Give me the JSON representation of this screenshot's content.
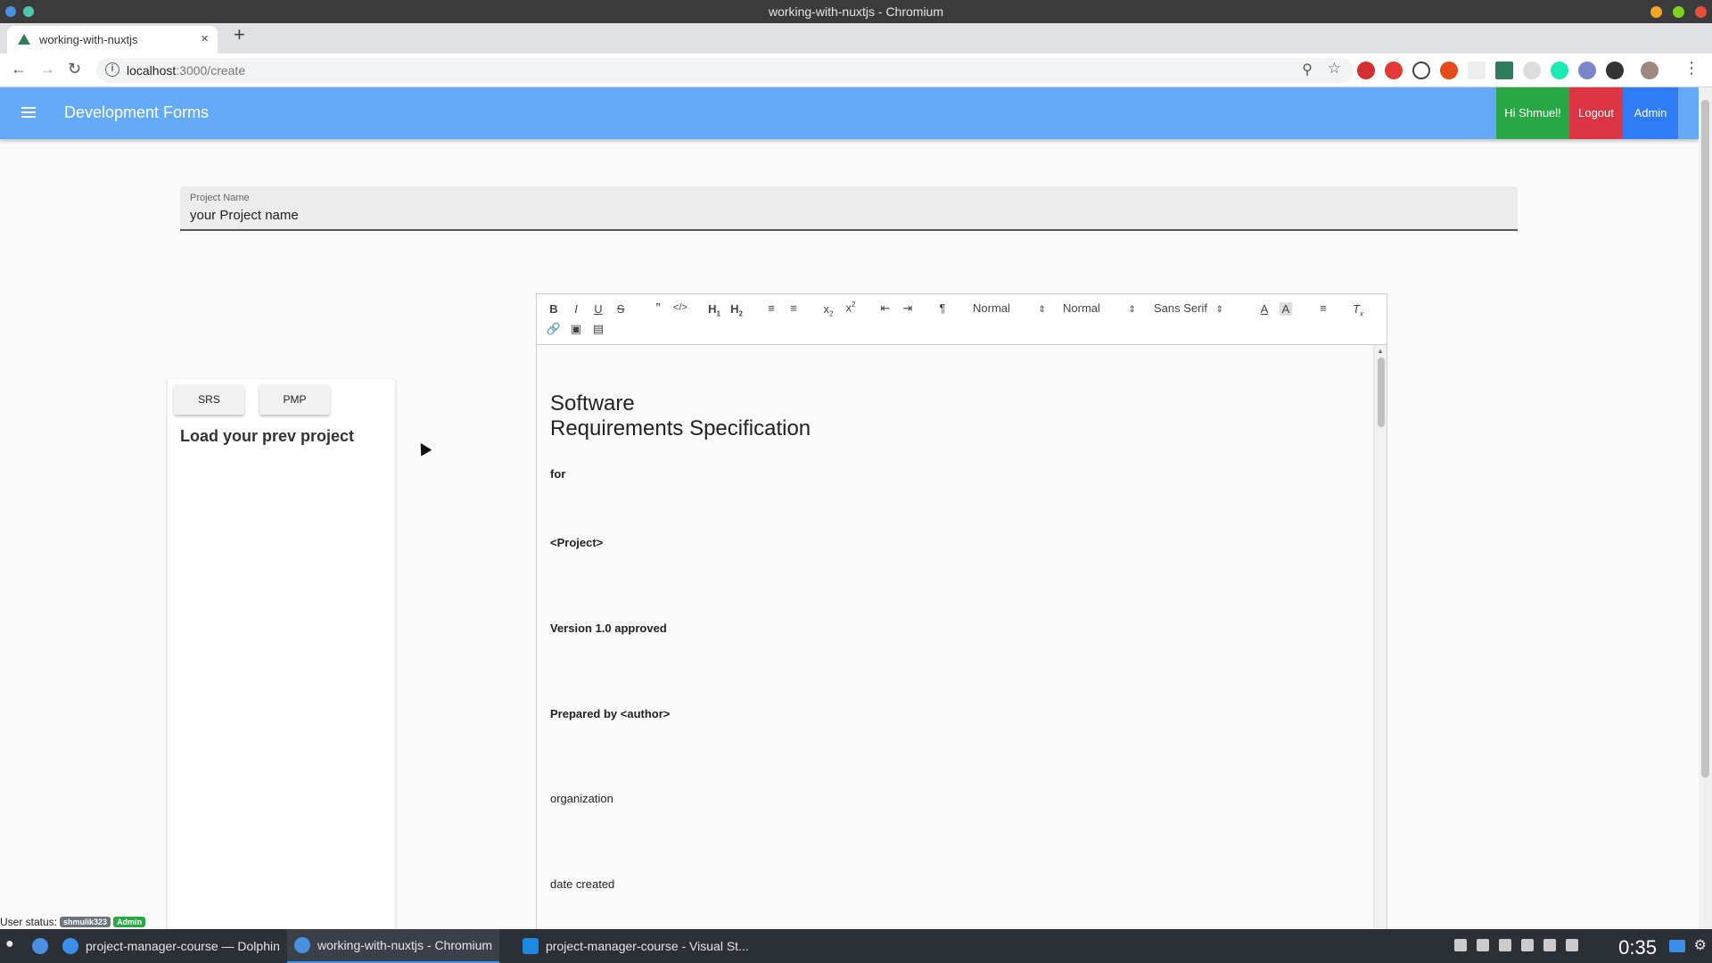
{
  "window": {
    "title": "working-with-nuxtjs - Chromium"
  },
  "browser": {
    "tab_title": "working-with-nuxtjs",
    "tab_close": "×",
    "new_tab": "+",
    "url_host": "localhost",
    "url_path": ":3000/create"
  },
  "app": {
    "title": "Development Forms",
    "greeting": "Hi Shmuel!",
    "logout": "Logout",
    "admin": "Admin"
  },
  "project_field": {
    "label": "Project Name",
    "value": "your Project name"
  },
  "toolbar": {
    "header_select": "Normal",
    "size_select": "Normal",
    "font_select": "Sans Serif"
  },
  "document": {
    "title_line1": "Software",
    "title_line2": "Requirements Specification",
    "for": "for",
    "project": "<Project>",
    "version": "Version 1.0 approved",
    "prepared": "Prepared by <author>",
    "organization": "organization",
    "date": "date created"
  },
  "side_card": {
    "srs_button": "SRS",
    "pmp_button": "PMP",
    "heading": "Load your prev project"
  },
  "status": {
    "label": "User status:",
    "user": "shmulik323",
    "role": "Admin"
  },
  "taskbar": {
    "task1": "project-manager-course — Dolphin",
    "task2": "working-with-nuxtjs - Chromium",
    "task3": "project-manager-course - Visual St...",
    "clock": "0:35"
  },
  "colors": {
    "appbar": "#64aaf9",
    "success": "#28a745",
    "danger": "#dc3545",
    "primary": "#2f7cf6"
  }
}
